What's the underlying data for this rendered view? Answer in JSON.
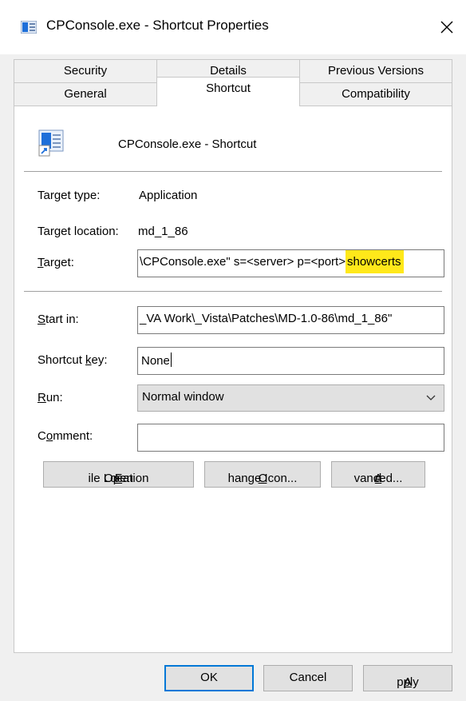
{
  "window": {
    "title": "CPConsole.exe - Shortcut Properties",
    "title_icon": "shortcut-app-icon",
    "close_glyph": "✕"
  },
  "tabs": {
    "row1": [
      {
        "label": "Security"
      },
      {
        "label": "Details"
      },
      {
        "label": "Previous Versions"
      }
    ],
    "row2": [
      {
        "label": "General"
      },
      {
        "label": "Shortcut",
        "active": true
      },
      {
        "label": "Compatibility"
      }
    ]
  },
  "shortcut": {
    "name": "CPConsole.exe - Shortcut",
    "target_type_label": "Target type:",
    "target_type_value": "Application",
    "target_location_label": "Target location:",
    "target_location_value": "md_1_86",
    "target_label_pre": "",
    "target_label_ul": "T",
    "target_label_post": "arget:",
    "target_value_main": "\\CPConsole.exe\" s=<server> p=<port>",
    "target_value_highlight": "showcerts",
    "start_in_label_pre": "",
    "start_in_label_ul": "S",
    "start_in_label_post": "tart in:",
    "start_in_value": "_VA Work\\_Vista\\Patches\\MD-1.0-86\\md_1_86\"",
    "shortcut_key_label_pre": "Shortcut ",
    "shortcut_key_label_ul": "k",
    "shortcut_key_label_post": "ey:",
    "shortcut_key_value": "None",
    "run_label_pre": "",
    "run_label_ul": "R",
    "run_label_post": "un:",
    "run_value": "Normal window",
    "comment_label_pre": "C",
    "comment_label_ul": "o",
    "comment_label_post": "mment:",
    "comment_value": ""
  },
  "actions": {
    "open_file_location_pre": "Open ",
    "open_file_location_ul": "F",
    "open_file_location_post": "ile Location",
    "change_icon_pre": "",
    "change_icon_ul": "C",
    "change_icon_post": "hange Icon...",
    "advanced_pre": "A",
    "advanced_ul": "d",
    "advanced_post": "vanced..."
  },
  "footer": {
    "ok": "OK",
    "cancel": "Cancel",
    "apply_ul": "A",
    "apply_post": "pply"
  },
  "colors": {
    "highlight": "#ffe81a",
    "accent": "#0078d7",
    "icon_blue": "#1e6fd9"
  }
}
